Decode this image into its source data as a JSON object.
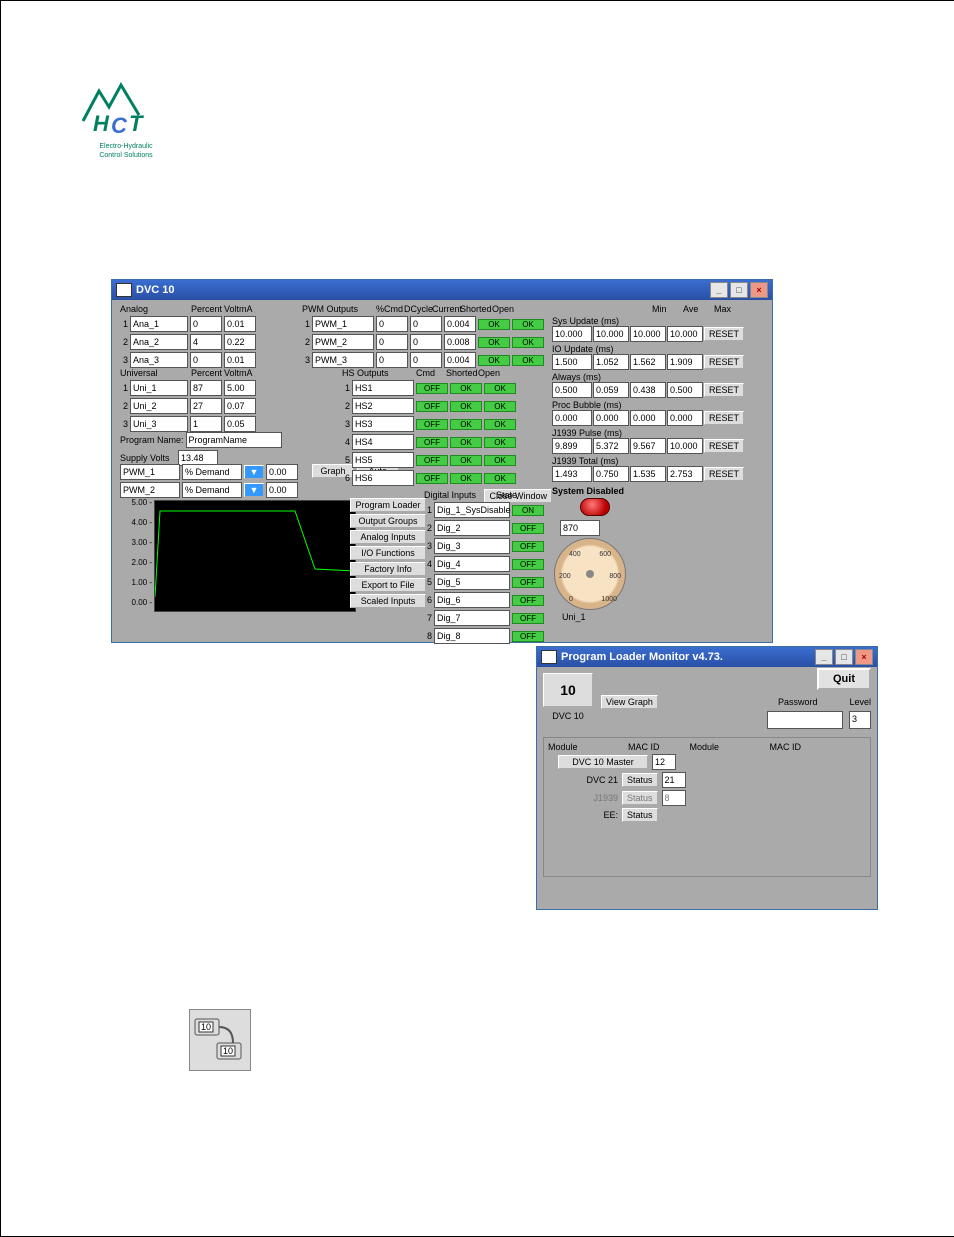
{
  "logo": {
    "line1": "Electro-Hydraulic",
    "line2": "Control Solutions",
    "brand": "HCT"
  },
  "dvc": {
    "title": "DVC 10",
    "analog": {
      "header": "Analog",
      "colA": "Percent",
      "colB": "VoltmA",
      "rows": [
        {
          "n": "1",
          "name": "Ana_1",
          "p": "0",
          "v": "0.01"
        },
        {
          "n": "2",
          "name": "Ana_2",
          "p": "4",
          "v": "0.22"
        },
        {
          "n": "3",
          "name": "Ana_3",
          "p": "0",
          "v": "0.01"
        }
      ]
    },
    "universal": {
      "header": "Universal",
      "colA": "Percent",
      "colB": "VoltmA",
      "rows": [
        {
          "n": "1",
          "name": "Uni_1",
          "p": "87",
          "v": "5.00"
        },
        {
          "n": "2",
          "name": "Uni_2",
          "p": "27",
          "v": "0.07"
        },
        {
          "n": "3",
          "name": "Uni_3",
          "p": "1",
          "v": "0.05"
        }
      ]
    },
    "program_name_label": "Program Name:",
    "program_name": "ProgramName",
    "supply_label": "Supply Volts",
    "supply": "13.48",
    "pwm_traces": [
      {
        "name": "PWM_1",
        "metric": "% Demand",
        "val": "0.00"
      },
      {
        "name": "PWM_2",
        "metric": "% Demand",
        "val": "0.00"
      }
    ],
    "graph_btn": "Graph",
    "auto_btn": "Auto",
    "y_ticks": [
      "5.00 -",
      "4.00 -",
      "3.00 -",
      "2.00 -",
      "1.00 -",
      "0.00 -"
    ],
    "pwm_out": {
      "header": "PWM Outputs",
      "cols": [
        "%Cmd",
        "DCycle",
        "Current",
        "Shorted",
        "Open"
      ],
      "rows": [
        {
          "n": "1",
          "name": "PWM_1",
          "a": "0",
          "b": "0",
          "c": "0.004",
          "s": "OK",
          "o": "OK"
        },
        {
          "n": "2",
          "name": "PWM_2",
          "a": "0",
          "b": "0",
          "c": "0.008",
          "s": "OK",
          "o": "OK"
        },
        {
          "n": "3",
          "name": "PWM_3",
          "a": "0",
          "b": "0",
          "c": "0.004",
          "s": "OK",
          "o": "OK"
        }
      ]
    },
    "hs_out": {
      "header": "HS Outputs",
      "cols": [
        "Cmd",
        "Shorted",
        "Open"
      ],
      "rows": [
        {
          "n": "1",
          "name": "HS1",
          "c": "OFF",
          "s": "OK",
          "o": "OK"
        },
        {
          "n": "2",
          "name": "HS2",
          "c": "OFF",
          "s": "OK",
          "o": "OK"
        },
        {
          "n": "3",
          "name": "HS3",
          "c": "OFF",
          "s": "OK",
          "o": "OK"
        },
        {
          "n": "4",
          "name": "HS4",
          "c": "OFF",
          "s": "OK",
          "o": "OK"
        },
        {
          "n": "5",
          "name": "HS5",
          "c": "OFF",
          "s": "OK",
          "o": "OK"
        },
        {
          "n": "6",
          "name": "HS6",
          "c": "OFF",
          "s": "OK",
          "o": "OK"
        }
      ]
    },
    "close_btn": "Close Window",
    "side_buttons": [
      "Program Loader",
      "Output Groups",
      "Analog Inputs",
      "I/O Functions",
      "Factory Info",
      "Export to File",
      "Scaled Inputs"
    ],
    "digital": {
      "header": "Digital Inputs",
      "state": "State",
      "rows": [
        {
          "n": "1",
          "name": "Dig_1_SysDisable",
          "s": "ON"
        },
        {
          "n": "2",
          "name": "Dig_2",
          "s": "OFF"
        },
        {
          "n": "3",
          "name": "Dig_3",
          "s": "OFF"
        },
        {
          "n": "4",
          "name": "Dig_4",
          "s": "OFF"
        },
        {
          "n": "5",
          "name": "Dig_5",
          "s": "OFF"
        },
        {
          "n": "6",
          "name": "Dig_6",
          "s": "OFF"
        },
        {
          "n": "7",
          "name": "Dig_7",
          "s": "OFF"
        },
        {
          "n": "8",
          "name": "Dig_8",
          "s": "OFF"
        }
      ]
    },
    "stats": {
      "cols": [
        "Min",
        "Ave",
        "Max"
      ],
      "reset": "RESET",
      "rows": [
        {
          "label": "Sys Update (ms)",
          "val": "10.000",
          "min": "10.000",
          "ave": "10.000",
          "max": "10.000"
        },
        {
          "label": "IO Update (ms)",
          "val": "1.500",
          "min": "1.052",
          "ave": "1.562",
          "max": "1.909"
        },
        {
          "label": "Always  (ms)",
          "val": "0.500",
          "min": "0.059",
          "ave": "0.438",
          "max": "0.500"
        },
        {
          "label": "Proc Bubble (ms)",
          "val": "0.000",
          "min": "0.000",
          "ave": "0.000",
          "max": "0.000"
        },
        {
          "label": "J1939 Pulse (ms)",
          "val": "9.899",
          "min": "5.372",
          "ave": "9.567",
          "max": "10.000"
        },
        {
          "label": "J1939 Total (ms)",
          "val": "1.493",
          "min": "0.750",
          "ave": "1.535",
          "max": "2.753"
        }
      ]
    },
    "system_disabled": "System Disabled",
    "gauge": {
      "readout": "870",
      "t200": "200",
      "t400": "400",
      "t600": "600",
      "t800": "800",
      "t0": "0",
      "t1000": "1000",
      "label": "Uni_1"
    }
  },
  "loader": {
    "title": "Program Loader Monitor v4.73.",
    "dvc10": "DVC 10",
    "view_graph": "View Graph",
    "quit": "Quit",
    "password_label": "Password",
    "password": "",
    "level_label": "Level",
    "level": "3",
    "module_hdr": "Module",
    "macid_hdr": "MAC ID",
    "rows": [
      {
        "name": "DVC 10 Master",
        "btn": "",
        "mac": "12",
        "enabled": true
      },
      {
        "name": "DVC 21",
        "btn": "Status",
        "mac": "21",
        "enabled": true
      },
      {
        "name": "J1939",
        "btn": "Status",
        "mac": "8",
        "enabled": false
      },
      {
        "name": "EE:",
        "btn": "Status",
        "mac": "",
        "enabled": true
      }
    ]
  },
  "footicon": {
    "a": "10",
    "b": "10"
  }
}
